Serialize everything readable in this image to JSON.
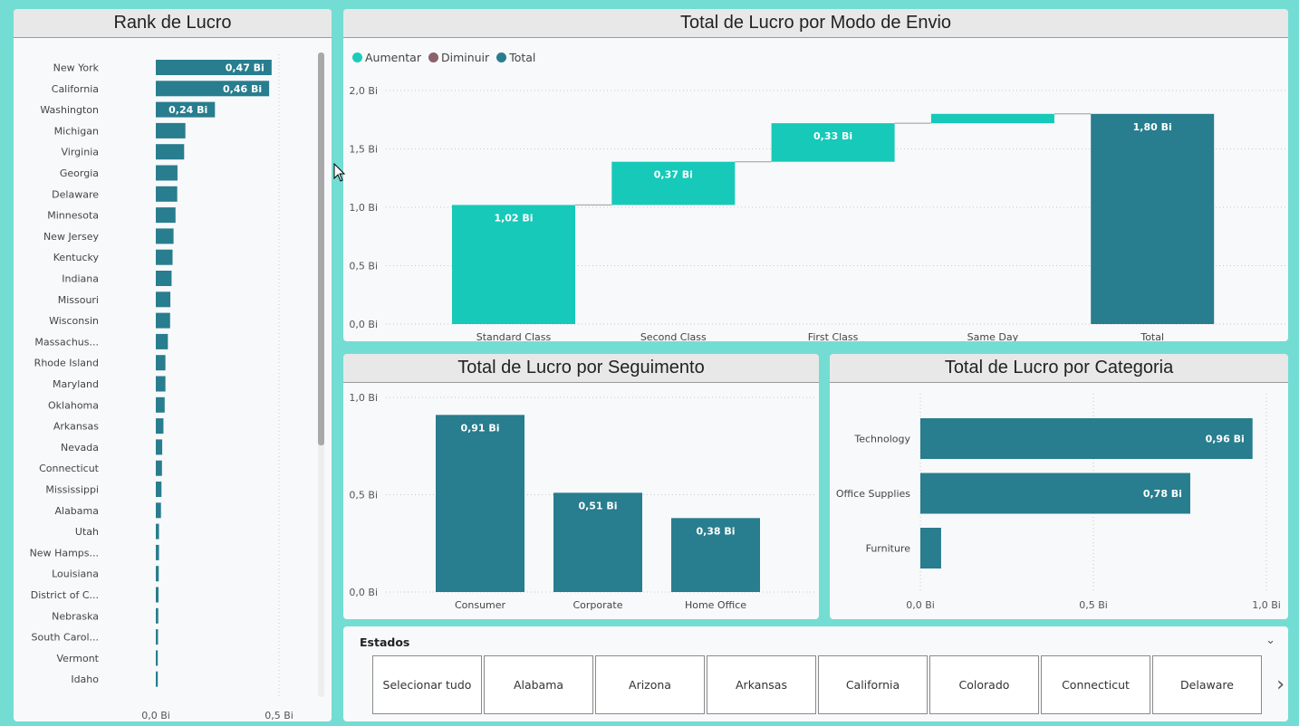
{
  "rank_panel": {
    "title": "Rank de Lucro"
  },
  "modo_panel": {
    "title": "Total de Lucro por Modo de Envio"
  },
  "seg_panel": {
    "title": "Total de Lucro por Seguimento"
  },
  "cat_panel": {
    "title": "Total de Lucro por Categoria"
  },
  "legend": [
    {
      "label": "Aumentar",
      "color": "#1ccbb9"
    },
    {
      "label": "Diminuir",
      "color": "#8c6168"
    },
    {
      "label": "Total",
      "color": "#287d8e"
    }
  ],
  "colors": {
    "bar": "#287d8e",
    "increase": "#16c9b8",
    "connector": "#9a9a9a"
  },
  "chart_data": [
    {
      "type": "bar",
      "orientation": "horizontal",
      "title": "Rank de Lucro",
      "categories": [
        "New York",
        "California",
        "Washington",
        "Michigan",
        "Virginia",
        "Georgia",
        "Delaware",
        "Minnesota",
        "New Jersey",
        "Kentucky",
        "Indiana",
        "Missouri",
        "Wisconsin",
        "Massachus...",
        "Rhode Island",
        "Maryland",
        "Oklahoma",
        "Arkansas",
        "Nevada",
        "Connecticut",
        "Mississippi",
        "Alabama",
        "Utah",
        "New Hamps...",
        "Louisiana",
        "District of C...",
        "Nebraska",
        "South Carol...",
        "Vermont",
        "Idaho"
      ],
      "values": [
        0.47,
        0.46,
        0.24,
        0.12,
        0.115,
        0.088,
        0.087,
        0.08,
        0.072,
        0.068,
        0.064,
        0.059,
        0.058,
        0.049,
        0.039,
        0.039,
        0.036,
        0.031,
        0.026,
        0.025,
        0.023,
        0.021,
        0.013,
        0.013,
        0.012,
        0.011,
        0.01,
        0.009,
        0.008,
        0.008
      ],
      "data_labels": [
        "0,47 Bi",
        "0,46 Bi",
        "0,24 Bi"
      ],
      "xlim": [
        0,
        0.5
      ],
      "xticks": [
        "0,0 Bi",
        "0,5 Bi"
      ]
    },
    {
      "type": "waterfall",
      "title": "Total de Lucro por Modo de Envio",
      "categories": [
        "Standard Class",
        "Second Class",
        "First Class",
        "Same Day",
        "Total"
      ],
      "values": [
        1.02,
        0.37,
        0.33,
        0.08,
        1.8
      ],
      "kinds": [
        "increase",
        "increase",
        "increase",
        "increase",
        "total"
      ],
      "data_labels": [
        "1,02 Bi",
        "0,37 Bi",
        "0,33 Bi",
        "",
        "1,80 Bi"
      ],
      "ylim": [
        0,
        2.0
      ],
      "yticks": [
        "0,0 Bi",
        "0,5 Bi",
        "1,0 Bi",
        "1,5 Bi",
        "2,0 Bi"
      ]
    },
    {
      "type": "bar",
      "title": "Total de Lucro por Seguimento",
      "categories": [
        "Consumer",
        "Corporate",
        "Home Office"
      ],
      "values": [
        0.91,
        0.51,
        0.38
      ],
      "data_labels": [
        "0,91 Bi",
        "0,51 Bi",
        "0,38 Bi"
      ],
      "ylim": [
        0,
        1.0
      ],
      "yticks": [
        "0,0 Bi",
        "0,5 Bi",
        "1,0 Bi"
      ]
    },
    {
      "type": "bar",
      "orientation": "horizontal",
      "title": "Total de Lucro por Categoria",
      "categories": [
        "Technology",
        "Office Supplies",
        "Furniture"
      ],
      "values": [
        0.96,
        0.78,
        0.06
      ],
      "data_labels": [
        "0,96 Bi",
        "0,78 Bi",
        ""
      ],
      "xlim": [
        0,
        1.0
      ],
      "xticks": [
        "0,0 Bi",
        "0,5 Bi",
        "1,0 Bi"
      ]
    }
  ],
  "slicer": {
    "title": "Estados",
    "tiles": [
      "Selecionar tudo",
      "Alabama",
      "Arizona",
      "Arkansas",
      "California",
      "Colorado",
      "Connecticut",
      "Delaware"
    ]
  }
}
